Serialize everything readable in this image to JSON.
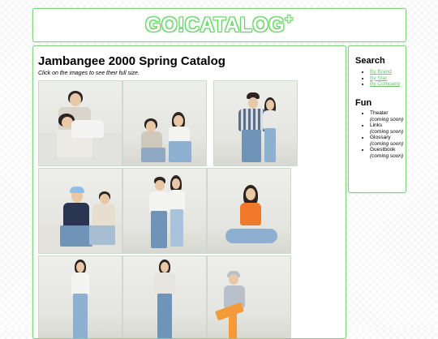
{
  "header": {
    "logo_text": "GO!CATALOG",
    "logo_plus": "+"
  },
  "main": {
    "title": "Jambangee 2000 Spring Catalog",
    "subtitle": "Click on the images to see their full size."
  },
  "sidebar": {
    "search_heading": "Search",
    "search_links": [
      "By Brand",
      "By Star",
      "By Company"
    ],
    "fun_heading": "Fun",
    "fun_items": [
      {
        "label": "Theater",
        "note": "(coming soon)"
      },
      {
        "label": "Links",
        "note": "(coming soon)"
      },
      {
        "label": "Glossary",
        "note": "(coming soon)"
      },
      {
        "label": "Guestbook",
        "note": "(coming soon)"
      }
    ]
  },
  "colors": {
    "accent_green": "#7fd07f",
    "logo_glow": "#5fd25f",
    "link_green": "#6cc56c",
    "denim": "#6f94b8",
    "white_tee": "#f4f4f2",
    "orange_top": "#f07a2a",
    "navy_top": "#2a3552",
    "plaid": "#5a6f8a"
  }
}
